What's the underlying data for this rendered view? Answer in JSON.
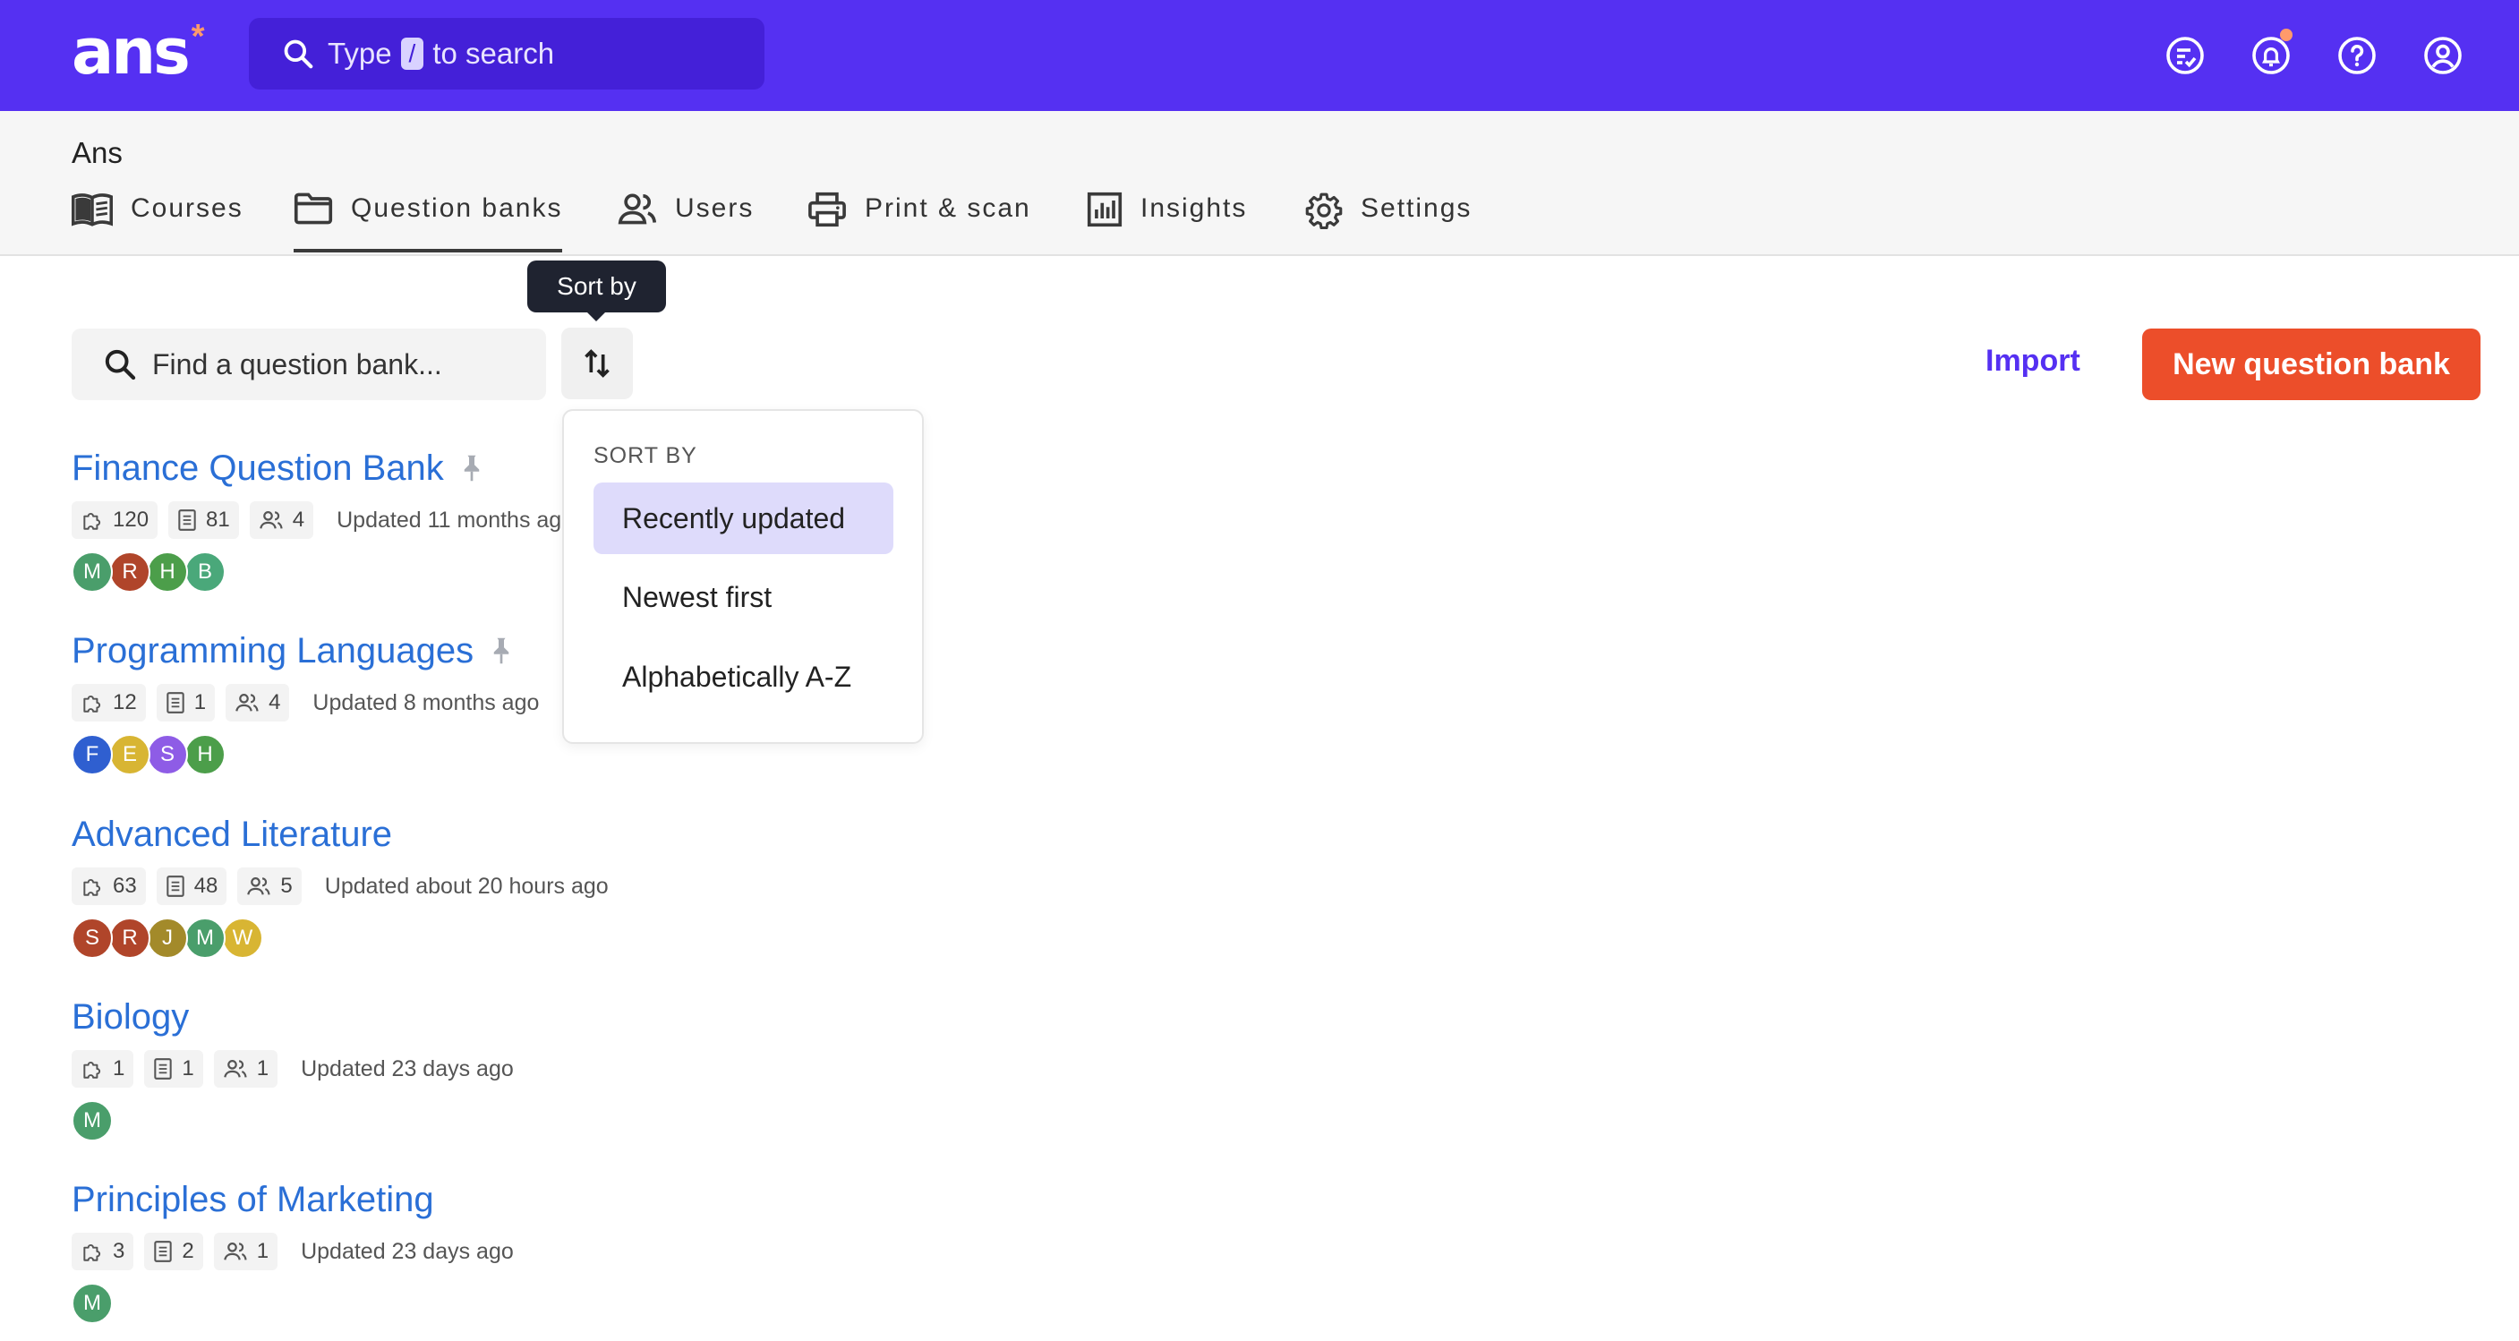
{
  "topbar": {
    "logo_text": "ans",
    "logo_star": "*",
    "search": {
      "prefix": "Type",
      "key": "/",
      "suffix": "to search"
    },
    "icons": [
      "assignments-icon",
      "bell-icon",
      "help-icon",
      "account-icon"
    ],
    "colors": {
      "brand": "#5530f2",
      "notification_dot": "#ff9a6b"
    }
  },
  "org": {
    "name": "Ans"
  },
  "tabs": [
    {
      "label": "Courses",
      "icon": "book-icon"
    },
    {
      "label": "Question banks",
      "icon": "folder-icon",
      "active": true
    },
    {
      "label": "Users",
      "icon": "users-icon"
    },
    {
      "label": "Print & scan",
      "icon": "printer-icon"
    },
    {
      "label": "Insights",
      "icon": "chart-icon"
    },
    {
      "label": "Settings",
      "icon": "gear-icon"
    }
  ],
  "toolbar": {
    "find_placeholder": "Find a question bank...",
    "sort_tooltip": "Sort by",
    "import_label": "Import",
    "new_label": "New question bank",
    "colors": {
      "primary_button": "#ec4e2a"
    }
  },
  "sort_menu": {
    "header": "SORT BY",
    "options": [
      {
        "label": "Recently updated",
        "selected": true
      },
      {
        "label": "Newest first"
      },
      {
        "label": "Alphabetically A-Z"
      }
    ]
  },
  "banks": [
    {
      "title": "Finance Question Bank",
      "pinned": true,
      "questions": "120",
      "exercises": "81",
      "members": "4",
      "updated": "Updated 11 months ago",
      "avatars": [
        {
          "letter": "M",
          "color": "#4a9e6b"
        },
        {
          "letter": "R",
          "color": "#b0452a"
        },
        {
          "letter": "H",
          "color": "#4c9e4a"
        },
        {
          "letter": "B",
          "color": "#4aa87a"
        }
      ]
    },
    {
      "title": "Programming Languages",
      "pinned": true,
      "questions": "12",
      "exercises": "1",
      "members": "4",
      "updated": "Updated 8 months ago",
      "avatars": [
        {
          "letter": "F",
          "color": "#2f5fd0"
        },
        {
          "letter": "E",
          "color": "#d8b533"
        },
        {
          "letter": "S",
          "color": "#8e5ce6"
        },
        {
          "letter": "H",
          "color": "#4c9e4a"
        }
      ]
    },
    {
      "title": "Advanced Literature",
      "pinned": false,
      "questions": "63",
      "exercises": "48",
      "members": "5",
      "updated": "Updated about 20 hours ago",
      "avatars": [
        {
          "letter": "S",
          "color": "#b0452a"
        },
        {
          "letter": "R",
          "color": "#b0452a"
        },
        {
          "letter": "J",
          "color": "#a38a2a"
        },
        {
          "letter": "M",
          "color": "#4a9e6b"
        },
        {
          "letter": "W",
          "color": "#d8b533"
        }
      ]
    },
    {
      "title": "Biology",
      "pinned": false,
      "questions": "1",
      "exercises": "1",
      "members": "1",
      "updated": "Updated 23 days ago",
      "avatars": [
        {
          "letter": "M",
          "color": "#4a9e6b"
        }
      ]
    },
    {
      "title": "Principles of Marketing",
      "pinned": false,
      "questions": "3",
      "exercises": "2",
      "members": "1",
      "updated": "Updated 23 days ago",
      "avatars": [
        {
          "letter": "M",
          "color": "#4a9e6b"
        }
      ]
    }
  ]
}
